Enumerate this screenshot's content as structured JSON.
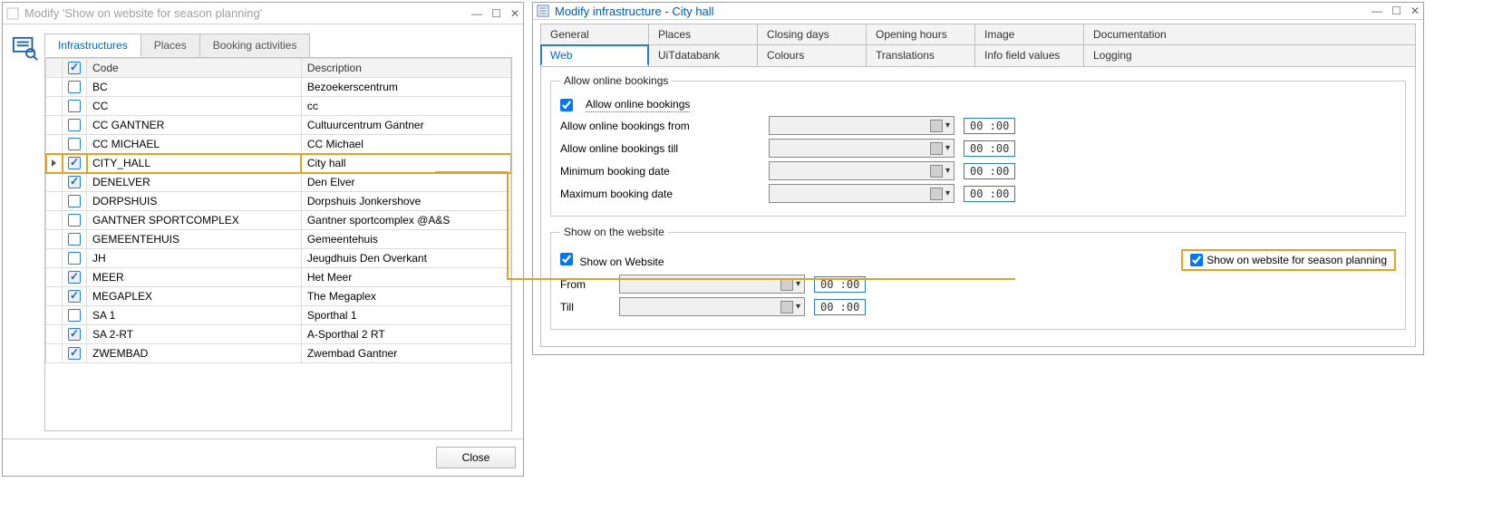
{
  "left_window": {
    "title": "Modify 'Show on website for season planning'",
    "tabs": {
      "infrastructures": "Infrastructures",
      "places": "Places",
      "booking_activities": "Booking activities"
    },
    "grid": {
      "headers": {
        "code": "Code",
        "description": "Description"
      },
      "rows": [
        {
          "checked": false,
          "code": "BC",
          "desc": "Bezoekerscentrum"
        },
        {
          "checked": false,
          "code": "CC",
          "desc": "cc"
        },
        {
          "checked": false,
          "code": "CC GANTNER",
          "desc": "Cultuurcentrum Gantner"
        },
        {
          "checked": false,
          "code": "CC MICHAEL",
          "desc": "CC Michael"
        },
        {
          "checked": true,
          "code": "CITY_HALL",
          "desc": "City hall",
          "current": true
        },
        {
          "checked": true,
          "code": "DENELVER",
          "desc": "Den Elver"
        },
        {
          "checked": false,
          "code": "DORPSHUIS",
          "desc": "Dorpshuis Jonkershove"
        },
        {
          "checked": false,
          "code": "GANTNER SPORTCOMPLEX",
          "desc": "Gantner sportcomplex @A&S"
        },
        {
          "checked": false,
          "code": "GEMEENTEHUIS",
          "desc": "Gemeentehuis"
        },
        {
          "checked": false,
          "code": "JH",
          "desc": "Jeugdhuis Den Overkant"
        },
        {
          "checked": true,
          "code": "MEER",
          "desc": "Het Meer"
        },
        {
          "checked": true,
          "code": "MEGAPLEX",
          "desc": "The Megaplex"
        },
        {
          "checked": false,
          "code": "SA 1",
          "desc": "Sporthal 1"
        },
        {
          "checked": true,
          "code": "SA 2-RT",
          "desc": "A-Sporthal 2 RT"
        },
        {
          "checked": true,
          "code": "ZWEMBAD",
          "desc": "Zwembad Gantner"
        }
      ]
    },
    "close_button": "Close"
  },
  "right_window": {
    "title": "Modify infrastructure - City hall",
    "tabs_row1": {
      "general": "General",
      "places": "Places",
      "closing_days": "Closing days",
      "opening_hours": "Opening hours",
      "image": "Image",
      "documentation": "Documentation"
    },
    "tabs_row2": {
      "web": "Web",
      "uit": "UiTdatabank",
      "colours": "Colours",
      "translations": "Translations",
      "info": "Info field values",
      "logging": "Logging"
    },
    "allow_group": {
      "legend": "Allow online bookings",
      "allow_cb": "Allow online bookings",
      "from": "Allow online bookings from",
      "till": "Allow online bookings till",
      "min": "Minimum booking date",
      "max": "Maximum booking date",
      "time": "00 :00"
    },
    "show_group": {
      "legend": "Show on the website",
      "show_cb": "Show on Website",
      "season_cb": "Show on website for season planning",
      "from": "From",
      "till": "Till",
      "time": "00 :00"
    }
  }
}
